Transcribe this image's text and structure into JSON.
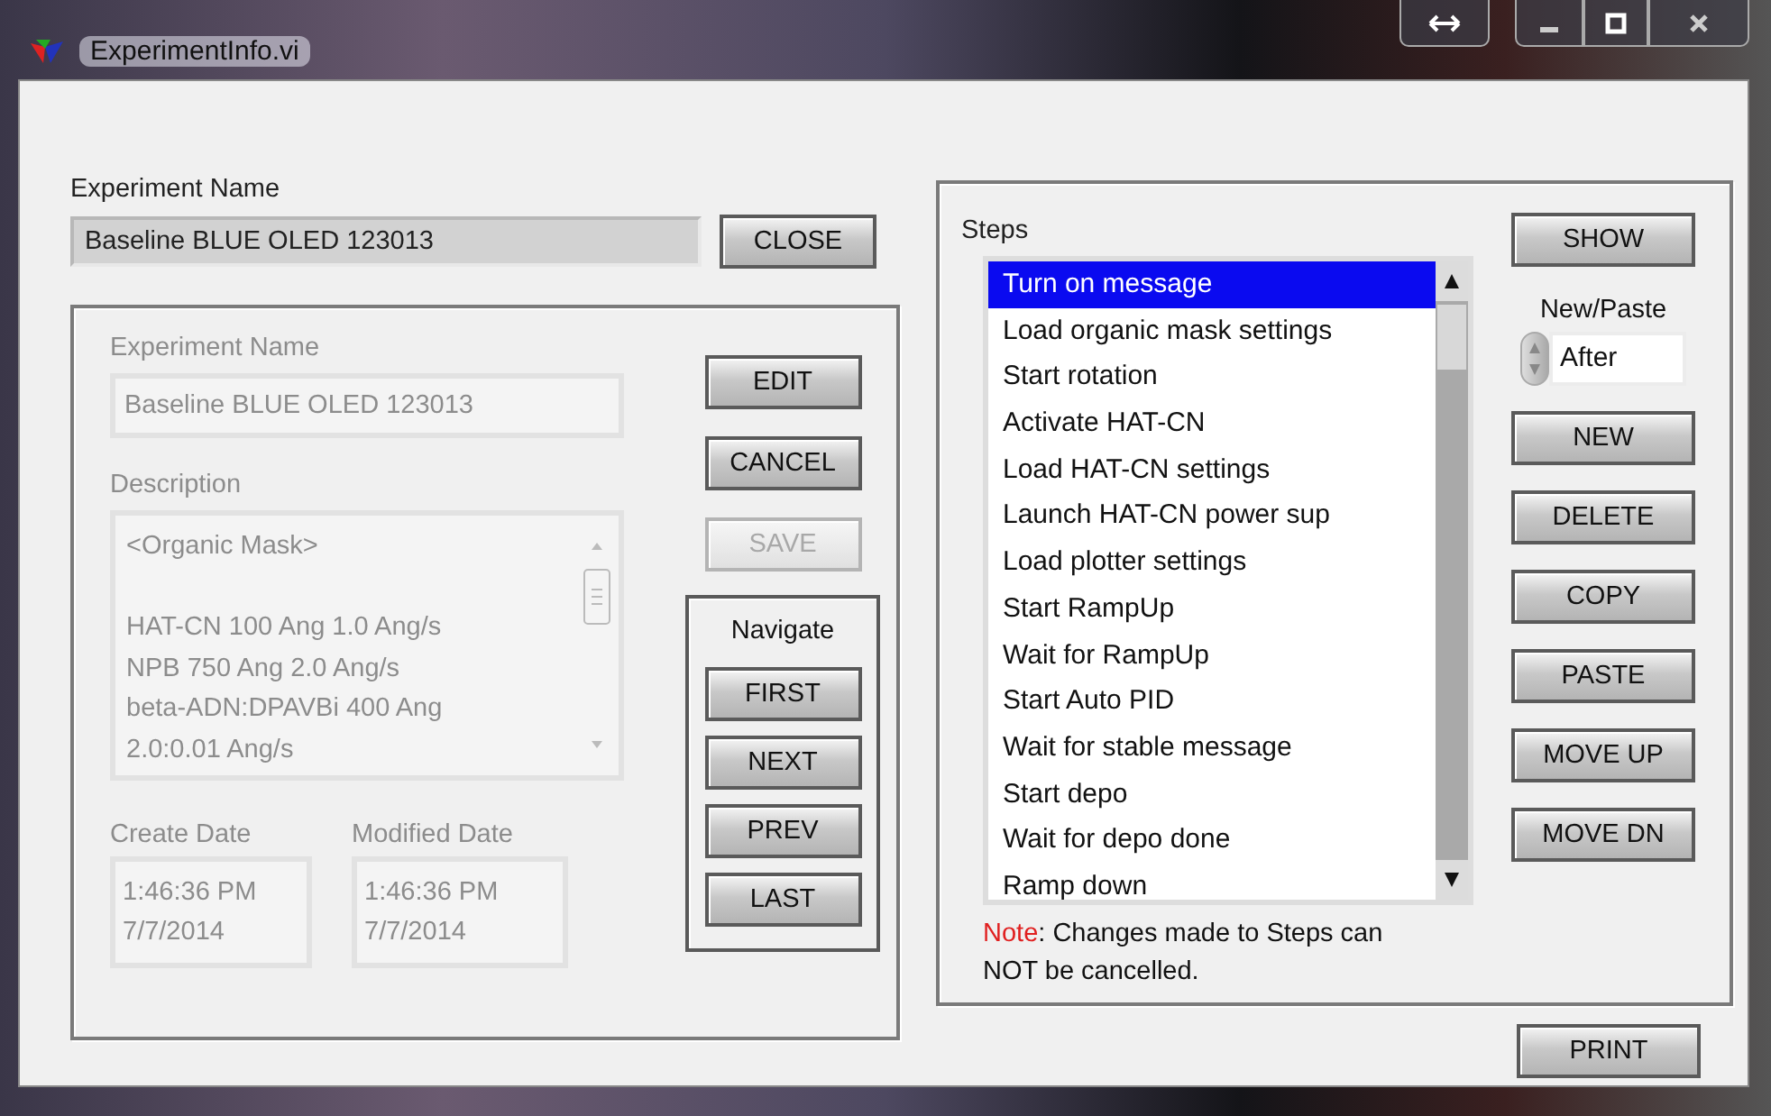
{
  "window": {
    "title": "ExperimentInfo.vi"
  },
  "experiment_name": {
    "label": "Experiment Name",
    "value": "Baseline BLUE OLED 123013"
  },
  "close_button": {
    "label": "CLOSE"
  },
  "details": {
    "disabled": true,
    "name_label": "Experiment Name",
    "name_value": "Baseline BLUE OLED 123013",
    "description_label": "Description",
    "description": "<Organic Mask>\n\nHAT-CN 100 Ang 1.0 Ang/s\nNPB 750 Ang 2.0 Ang/s\nbeta-ADN:DPAVBi 400 Ang\n2.0:0.01 Ang/s",
    "create_date_label": "Create Date",
    "create_date": "1:46:36 PM\n7/7/2014",
    "modified_date_label": "Modified Date",
    "modified_date": "1:46:36 PM\n7/7/2014",
    "buttons": [
      {
        "label": "EDIT",
        "disabled": false
      },
      {
        "label": "CANCEL",
        "disabled": false
      },
      {
        "label": "SAVE",
        "disabled": true
      }
    ],
    "navigate": {
      "title": "Navigate",
      "buttons": [
        {
          "label": "FIRST",
          "disabled": false
        },
        {
          "label": "NEXT",
          "disabled": false
        },
        {
          "label": "PREV",
          "disabled": false
        },
        {
          "label": "LAST",
          "disabled": false
        }
      ]
    }
  },
  "steps": {
    "label": "Steps",
    "items": [
      {
        "label": "Turn on message",
        "selected": true
      },
      {
        "label": "Load organic mask settings",
        "selected": false
      },
      {
        "label": "Start rotation",
        "selected": false
      },
      {
        "label": "Activate HAT-CN",
        "selected": false
      },
      {
        "label": "Load HAT-CN settings",
        "selected": false
      },
      {
        "label": "Launch HAT-CN power sup",
        "selected": false
      },
      {
        "label": "Load plotter settings",
        "selected": false
      },
      {
        "label": "Start RampUp",
        "selected": false
      },
      {
        "label": "Wait for RampUp",
        "selected": false
      },
      {
        "label": "Start Auto PID",
        "selected": false
      },
      {
        "label": "Wait for stable message",
        "selected": false
      },
      {
        "label": "Start depo",
        "selected": false
      },
      {
        "label": "Wait for depo done",
        "selected": false
      },
      {
        "label": "Ramp down",
        "selected": false
      }
    ],
    "note": {
      "label": "Note",
      "text": ": Changes made to Steps can NOT be cancelled."
    }
  },
  "step_controls": [
    {
      "kind": "button",
      "label": "SHOW"
    },
    {
      "kind": "ring",
      "label": "New/Paste",
      "value": "After"
    },
    {
      "kind": "button",
      "label": "NEW"
    },
    {
      "kind": "button",
      "label": "DELETE"
    },
    {
      "kind": "button",
      "label": "COPY"
    },
    {
      "kind": "button",
      "label": "PASTE"
    },
    {
      "kind": "button",
      "label": "MOVE UP"
    },
    {
      "kind": "button",
      "label": "MOVE DN"
    }
  ],
  "print_button": {
    "label": "PRINT"
  }
}
